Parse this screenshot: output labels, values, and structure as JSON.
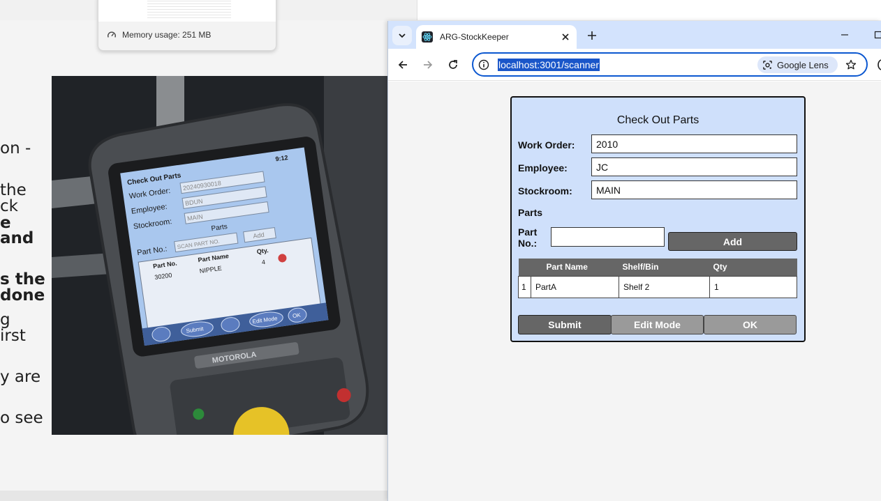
{
  "background": {
    "memory_tooltip": {
      "text": "Memory usage: 251 MB"
    },
    "article_fragments": [
      {
        "text": "on -",
        "bold": false
      },
      {
        "text": "the",
        "bold": false
      },
      {
        "text": "ck",
        "bold": false
      },
      {
        "text": "e",
        "bold": true
      },
      {
        "text": "and",
        "bold": true
      },
      {
        "text": "s the",
        "bold": true
      },
      {
        "text": "done",
        "bold": true
      },
      {
        "text": "g",
        "bold": false
      },
      {
        "text": "irst",
        "bold": false
      },
      {
        "text": "y are",
        "bold": false
      },
      {
        "text": "o see",
        "bold": false
      }
    ],
    "device_photo": {
      "title": "Check Out Parts",
      "time": "9:12",
      "work_order_label": "Work Order:",
      "work_order_value": "20240930018",
      "employee_label": "Employee:",
      "employee_value": "BDUN",
      "stockroom_label": "Stockroom:",
      "stockroom_value": "MAIN",
      "parts_label": "Parts",
      "part_no_label": "Part No.:",
      "part_no_placeholder": "SCAN PART NO.",
      "add_label": "Add",
      "col_part_no": "Part No.",
      "col_part_name": "Part Name",
      "col_qty": "Qty.",
      "row_part_no": "30200",
      "row_part_name": "NIPPLE",
      "row_qty": "4",
      "submit_label": "Submit",
      "edit_mode_label": "Edit Mode",
      "ok_label": "OK",
      "brand": "MOTOROLA"
    }
  },
  "browser": {
    "tab": {
      "title": "ARG-StockKeeper"
    },
    "url": "localhost:3001/scanner",
    "lens_label": "Google Lens"
  },
  "scanner": {
    "title": "Check Out Parts",
    "fields": {
      "work_order": {
        "label": "Work Order:",
        "value": "2010"
      },
      "employee": {
        "label": "Employee:",
        "value": "JC"
      },
      "stockroom": {
        "label": "Stockroom:",
        "value": "MAIN"
      }
    },
    "parts_heading": "Parts",
    "part_no_label": "Part No.:",
    "part_no_value": "",
    "add_label": "Add",
    "table": {
      "headers": [
        "",
        "Part Name",
        "Shelf/Bin",
        "Qty"
      ],
      "rows": [
        [
          "1",
          "PartA",
          "Shelf 2",
          "1"
        ]
      ]
    },
    "buttons": {
      "submit": "Submit",
      "edit_mode": "Edit Mode",
      "ok": "OK"
    }
  },
  "colors": {
    "tab_strip": "#d3e3fd",
    "omnibox_focus": "#0b57d0",
    "scanner_panel": "#cfe0fb",
    "button_dark": "#666666",
    "button_light": "#9a9a9a"
  }
}
